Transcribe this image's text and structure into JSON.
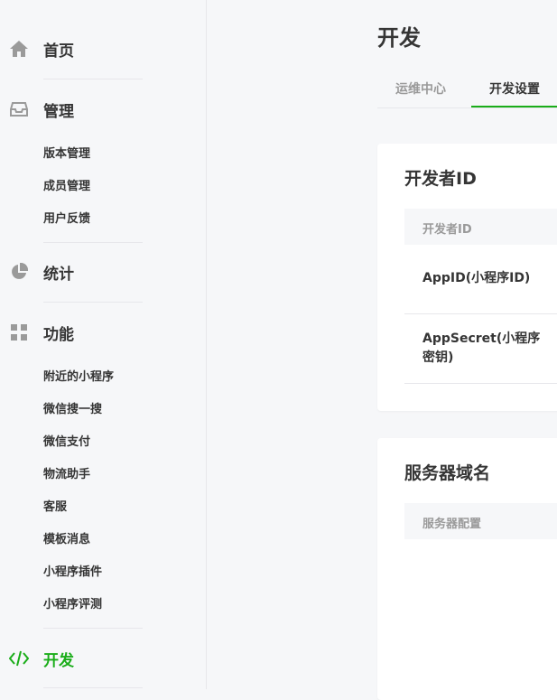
{
  "sidebar": {
    "home": "首页",
    "manage": "管理",
    "manage_items": [
      "版本管理",
      "成员管理",
      "用户反馈"
    ],
    "stats": "统计",
    "features": "功能",
    "feature_items": [
      "附近的小程序",
      "微信搜一搜",
      "微信支付",
      "物流助手",
      "客服",
      "模板消息",
      "小程序插件",
      "小程序评测"
    ],
    "develop": "开发"
  },
  "main": {
    "title": "开发",
    "tabs": [
      "运维中心",
      "开发设置"
    ],
    "active_tab": "开发设置",
    "dev_card": {
      "title": "开发者ID",
      "header": "开发者ID",
      "rows": [
        "AppID(小程序ID)",
        "AppSecret(小程序密钥)"
      ]
    },
    "server_card": {
      "title": "服务器域名",
      "header": "服务器配置"
    }
  },
  "colors": {
    "accent": "#1aad19",
    "icon": "#9a9a9a",
    "text": "#353535"
  }
}
